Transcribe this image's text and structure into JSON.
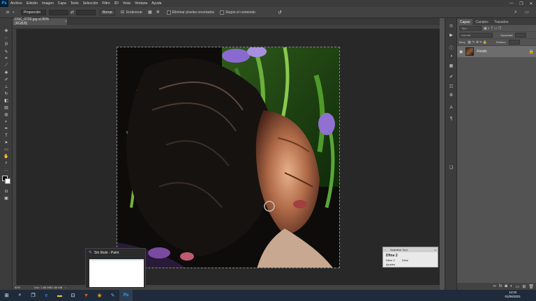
{
  "menubar": {
    "logo": "Ps",
    "items": [
      "Archivo",
      "Edición",
      "Imagen",
      "Capa",
      "Texto",
      "Selección",
      "Filtro",
      "3D",
      "Vista",
      "Ventana",
      "Ayuda"
    ],
    "win_controls": [
      "—",
      "❐",
      "✕"
    ]
  },
  "options": {
    "ratio_label": "Proporción",
    "clear_label": "Borrar",
    "straighten_label": "Enderezar",
    "delete_cropped_label": "Eliminar píxeles recortados",
    "content_aware_label": "Según el contenido"
  },
  "document": {
    "tab_title": "DSC_0720.jpg al 80% (RGB/8)",
    "zoom": "80%",
    "doc_size": "Doc: 2,86 MB/2,86 MB"
  },
  "layers_panel": {
    "tabs": [
      "Capas",
      "Canales",
      "Trazados"
    ],
    "kind_placeholder": "Tipo",
    "blend_mode": "Normal",
    "opacity_label": "Opacidad:",
    "lock_label": "Bloq:",
    "fill_label": "Relleno:",
    "layer_name": "Fondo"
  },
  "selective_tool": {
    "title": "Selective Tool",
    "filter": "Dfine 2",
    "option_1": "Dfine 2",
    "option_2": "Dfine",
    "settings": "Ajustes"
  },
  "paint_preview": {
    "title": "Sin título - Paint"
  },
  "taskbar": {
    "time": "14:02",
    "date": "01/06/2021"
  },
  "colors": {
    "accent": "#31a8ff",
    "chrome_dark": "#3c3c3c",
    "canvas_bg": "#282828",
    "taskbar": "#1f2a3a"
  }
}
